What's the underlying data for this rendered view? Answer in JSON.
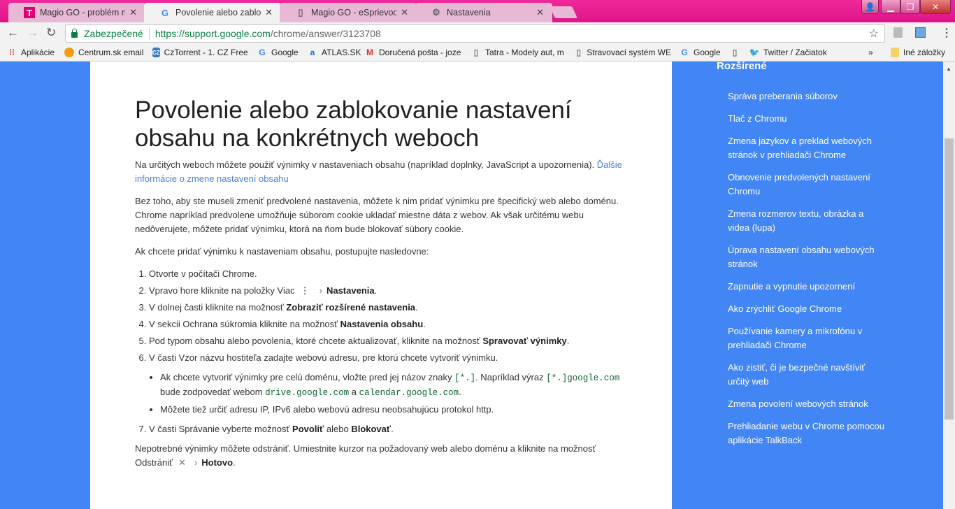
{
  "tabs": [
    {
      "label": "Magio GO - problém na",
      "icon": "telekom-icon",
      "active": false
    },
    {
      "label": "Povolenie alebo zablokov",
      "icon": "google-icon",
      "active": true
    },
    {
      "label": "Magio GO - eSprievodca",
      "icon": "page-icon",
      "active": false
    },
    {
      "label": "Nastavenia",
      "icon": "gear-icon",
      "active": false
    }
  ],
  "toolbar": {
    "secure_label": "Zabezpečené",
    "url_host": "https://support.google.com",
    "url_path": "/chrome/answer/3123708"
  },
  "bookmarks": [
    {
      "label": "Aplikácie",
      "icon": "apps-icon"
    },
    {
      "label": "Centrum.sk email",
      "icon": "centrum-icon"
    },
    {
      "label": "CzTorrent - 1. CZ Free",
      "icon": "cztorrent-icon"
    },
    {
      "label": "Google",
      "icon": "google-icon"
    },
    {
      "label": "ATLAS.SK",
      "icon": "atlas-icon"
    },
    {
      "label": "Doručená pošta - joze",
      "icon": "gmail-icon"
    },
    {
      "label": "Tatra - Modely aut, m",
      "icon": "page-icon"
    },
    {
      "label": "Stravovací systém WE",
      "icon": "page-icon"
    },
    {
      "label": "Google",
      "icon": "google-icon"
    },
    {
      "label": "",
      "icon": "page-icon"
    },
    {
      "label": "Twitter / Začiatok",
      "icon": "twitter-icon"
    }
  ],
  "bookmarks_more": "»",
  "other_bookmarks": "Iné záložky",
  "article": {
    "title": "Povolenie alebo zablokovanie nastavení obsahu na konkrétnych weboch",
    "intro": "Na určitých weboch môžete použiť výnimky v nastaveniach obsahu (napríklad doplnky, JavaScript a upozornenia). ",
    "intro_link": "Ďalšie informácie o zmene nastavení obsahu",
    "para2": "Bez toho, aby ste museli zmeniť predvolené nastavenia, môžete k nim pridať výnimku pre špecifický web alebo doménu. Chrome napríklad predvolene umožňuje súborom cookie ukladať miestne dáta z webov. Ak však určitému webu nedôverujete, môžete pridať výnimku, ktorá na ňom bude blokovať súbory cookie.",
    "para3": "Ak chcete pridať výnimku k nastaveniam obsahu, postupujte nasledovne:",
    "steps": [
      [
        {
          "t": "Otvorte v počítači Chrome."
        }
      ],
      [
        {
          "t": "Vpravo hore kliknite na položky Viac"
        },
        {
          "icon": "more-vert"
        },
        {
          "icon": "chevron"
        },
        {
          "t": "Nastavenia",
          "b": true
        },
        {
          "t": "."
        }
      ],
      [
        {
          "t": "V dolnej časti kliknite na možnosť "
        },
        {
          "t": "Zobraziť rozšírené nastavenia",
          "b": true
        },
        {
          "t": "."
        }
      ],
      [
        {
          "t": "V sekcii Ochrana súkromia kliknite na možnosť "
        },
        {
          "t": "Nastavenia obsahu",
          "b": true
        },
        {
          "t": "."
        }
      ],
      [
        {
          "t": "Pod typom obsahu alebo povolenia, ktoré chcete aktualizovať, kliknite na možnosť "
        },
        {
          "t": "Spravovať výnimky",
          "b": true
        },
        {
          "t": "."
        }
      ],
      [
        {
          "t": "V časti Vzor názvu hostiteľa zadajte webovú adresu, pre ktorú chcete vytvoriť výnimku."
        }
      ]
    ],
    "bullets": [
      [
        {
          "t": "Ak chcete vytvoriť výnimky pre celú doménu, vložte pred jej názov znaky "
        },
        {
          "t": "[*.]",
          "c": true
        },
        {
          "t": ". Napríklad výraz "
        },
        {
          "t": "[*.]google.com",
          "c": true
        },
        {
          "t": " bude zodpovedať webom "
        },
        {
          "t": "drive.google.com",
          "c": true
        },
        {
          "t": " a "
        },
        {
          "t": "calendar.google.com",
          "c": true
        },
        {
          "t": "."
        }
      ],
      [
        {
          "t": "Môžete tiež určiť adresu IP, IPv6 alebo webovú adresu neobsahujúcu protokol http."
        }
      ]
    ],
    "step7": [
      {
        "t": "V časti Správanie vyberte možnosť "
      },
      {
        "t": "Povoliť",
        "b": true
      },
      {
        "t": " alebo "
      },
      {
        "t": "Blokovať",
        "b": true
      },
      {
        "t": "."
      }
    ],
    "outro": [
      {
        "t": "Nepotrebné výnimky môžete odstrániť. Umiestnite kurzor na požadovaný web alebo doménu a kliknite na možnosť Odstrániť"
      },
      {
        "icon": "close"
      },
      {
        "icon": "chevron"
      },
      {
        "t": "Hotovo",
        "b": true
      },
      {
        "t": "."
      }
    ]
  },
  "sidebar": {
    "heading": "Rozšírené",
    "items": [
      "Správa preberania súborov",
      "Tlač z Chromu",
      "Zmena jazykov a preklad webových stránok v prehliadači Chrome",
      "Obnovenie predvolených nastavení Chromu",
      "Zmena rozmerov textu, obrázka a videa (lupa)",
      "Úprava nastavení obsahu webových stránok",
      "Zapnutie a vypnutie upozornení",
      "Ako zrýchliť Google Chrome",
      "Používanie kamery a mikrofónu v prehliadači Chrome",
      "Ako zistiť, či je bezpečné navštíviť určitý web",
      "Zmena povolení webových stránok",
      "Prehliadanie webu v Chrome pomocou aplikácie TalkBack"
    ]
  }
}
